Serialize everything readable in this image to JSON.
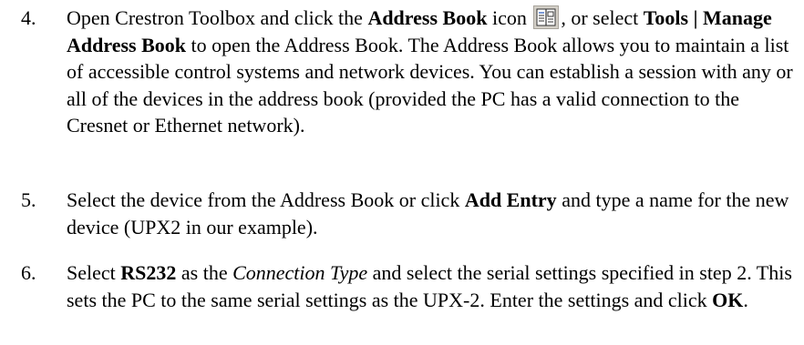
{
  "steps": [
    {
      "number": "4.",
      "segments": [
        {
          "text": "Open Crestron Toolbox and click the ",
          "style": "normal"
        },
        {
          "text": "Address Book",
          "style": "bold"
        },
        {
          "text": " icon ",
          "style": "normal"
        },
        {
          "icon": "address-book-icon"
        },
        {
          "text": ", or select ",
          "style": "normal"
        },
        {
          "text": "Tools | Manage Address Book",
          "style": "bold"
        },
        {
          "text": " to open the Address Book. The Address Book allows you to maintain a list of accessible control systems and network devices. You can establish a session with any or all of the devices in the address book (provided the PC has a valid connection to the Cresnet or Ethernet network).",
          "style": "normal"
        }
      ]
    },
    {
      "number": "5.",
      "segments": [
        {
          "text": "Select the device from the Address Book or click ",
          "style": "normal"
        },
        {
          "text": "Add Entry",
          "style": "bold"
        },
        {
          "text": " and type a name for the new device (UPX2 in our example).",
          "style": "normal"
        }
      ]
    },
    {
      "number": "6.",
      "segments": [
        {
          "text": "Select ",
          "style": "normal"
        },
        {
          "text": "RS232",
          "style": "bold"
        },
        {
          "text": " as the ",
          "style": "normal"
        },
        {
          "text": "Connection Type",
          "style": "italic"
        },
        {
          "text": " and select the serial settings specified in step 2. This sets the PC to the same serial settings as the UPX-2. Enter the settings and click ",
          "style": "normal"
        },
        {
          "text": "OK",
          "style": "bold"
        },
        {
          "text": ".",
          "style": "normal"
        }
      ]
    }
  ]
}
